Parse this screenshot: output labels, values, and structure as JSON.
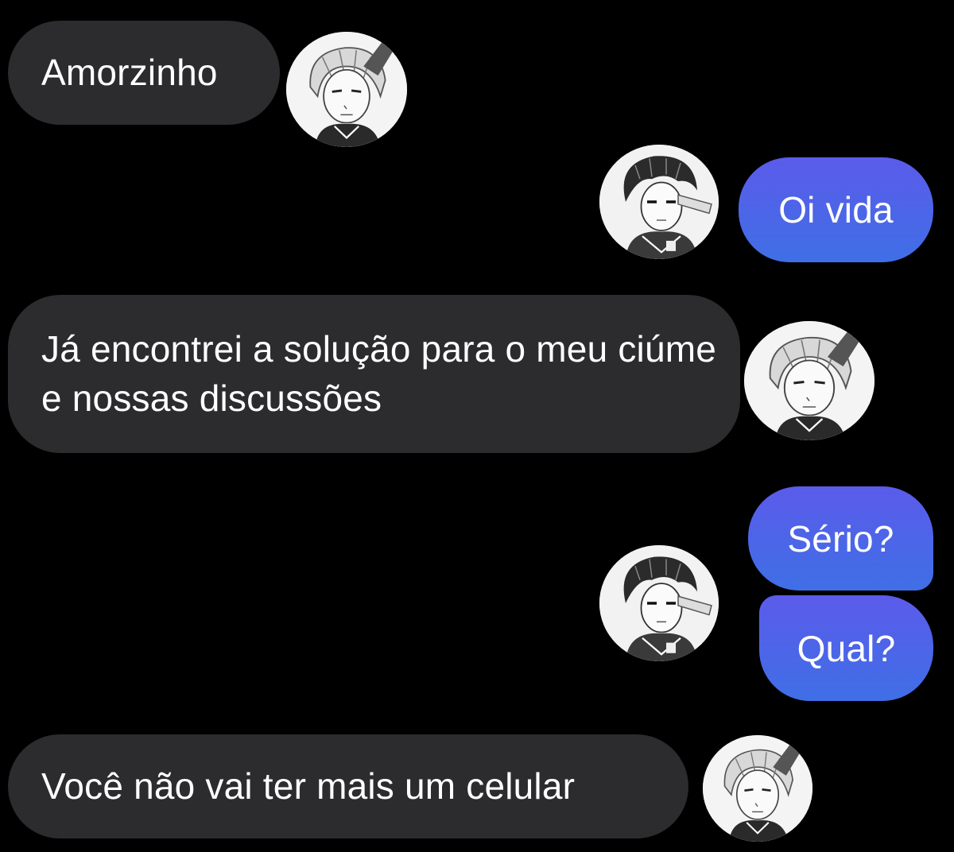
{
  "chat": {
    "colors": {
      "background": "#000000",
      "incoming_bubble": "#2c2c2e",
      "outgoing_bubble_top": "#5b5bea",
      "outgoing_bubble_bottom": "#3f6fe6",
      "text": "#ffffff"
    },
    "messages": [
      {
        "sender": "incoming",
        "avatar": "blonde-manga-character-icon",
        "text": "Amorzinho"
      },
      {
        "sender": "outgoing",
        "avatar": "dark-haired-manga-character-icon",
        "text": "Oi vida"
      },
      {
        "sender": "incoming",
        "avatar": "blonde-manga-character-icon",
        "text": "Já encontrei a solução para o meu ciúme e nossas discussões"
      },
      {
        "sender": "outgoing",
        "avatar": "dark-haired-manga-character-icon",
        "text": "Sério?"
      },
      {
        "sender": "outgoing",
        "avatar": "",
        "text": "Qual?"
      },
      {
        "sender": "incoming",
        "avatar": "blonde-manga-character-icon",
        "text": "Você não vai ter mais um celular"
      }
    ]
  }
}
